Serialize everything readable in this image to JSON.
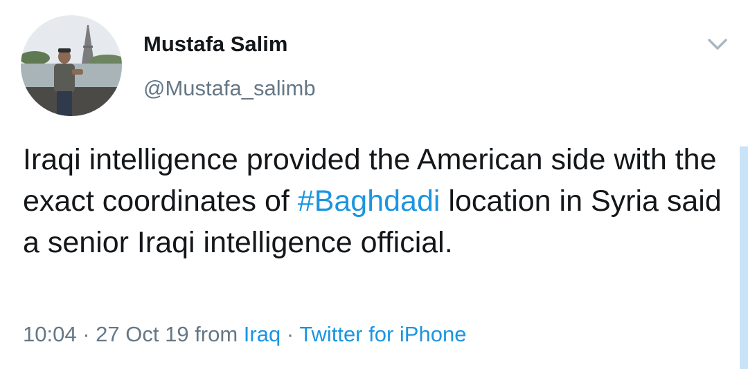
{
  "tweet": {
    "author": {
      "display_name": "Mustafa Salim",
      "handle": "@Mustafa_salimb"
    },
    "text_before_hashtag": "Iraqi intelligence provided the American side with the exact coordinates of ",
    "hashtag": "#Baghdadi",
    "text_after_hashtag": " location in Syria said a senior Iraqi intelligence official.",
    "meta": {
      "time": "10:04",
      "separator1": " · ",
      "date": "27 Oct 19",
      "from_label": " from ",
      "location": "Iraq",
      "separator2": " · ",
      "source": "Twitter for iPhone"
    }
  },
  "icons": {
    "menu": "chevron-down-icon",
    "avatar": "avatar"
  },
  "colors": {
    "link": "#1b95e0",
    "secondary_text": "#657786",
    "primary_text": "#14171a"
  }
}
